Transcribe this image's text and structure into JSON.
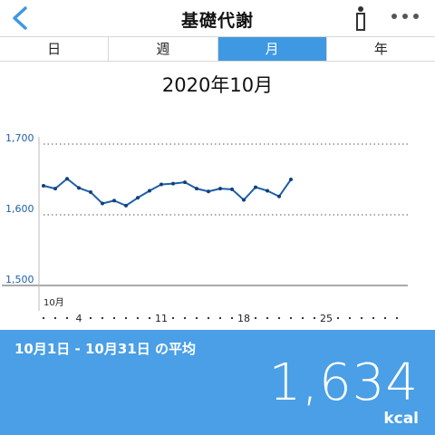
{
  "header": {
    "title": "基礎代謝",
    "back_icon": "chevron-left-icon",
    "info_icon": "info-icon",
    "more_icon": "more-dots-icon"
  },
  "tabs": [
    {
      "label": "日",
      "active": false
    },
    {
      "label": "週",
      "active": false
    },
    {
      "label": "月",
      "active": true
    },
    {
      "label": "年",
      "active": false
    }
  ],
  "period_title": "2020年10月",
  "colors": {
    "accent": "#3f98e2",
    "line": "#1f5fa8",
    "axis_label": "#1f5fa8"
  },
  "chart_data": {
    "type": "line",
    "title": "2020年10月",
    "x_month_label": "10月",
    "x_ticks": [
      "4",
      "11",
      "18",
      "25"
    ],
    "xlim": [
      1,
      31
    ],
    "ylim": [
      1500,
      1700
    ],
    "y_ticks": [
      "1,700",
      "1,600",
      "1,500"
    ],
    "grid": true,
    "x": [
      1,
      2,
      3,
      4,
      5,
      6,
      7,
      8,
      9,
      10,
      11,
      12,
      13,
      14,
      15,
      16,
      17,
      18,
      19,
      20,
      21,
      22
    ],
    "values": [
      1641,
      1637,
      1651,
      1638,
      1632,
      1616,
      1620,
      1613,
      1624,
      1634,
      1643,
      1644,
      1646,
      1637,
      1633,
      1637,
      1636,
      1621,
      1639,
      1634,
      1626,
      1650
    ]
  },
  "average": {
    "label": "10月1日 - 10月31日 の平均",
    "value": "1,634",
    "unit": "kcal"
  }
}
